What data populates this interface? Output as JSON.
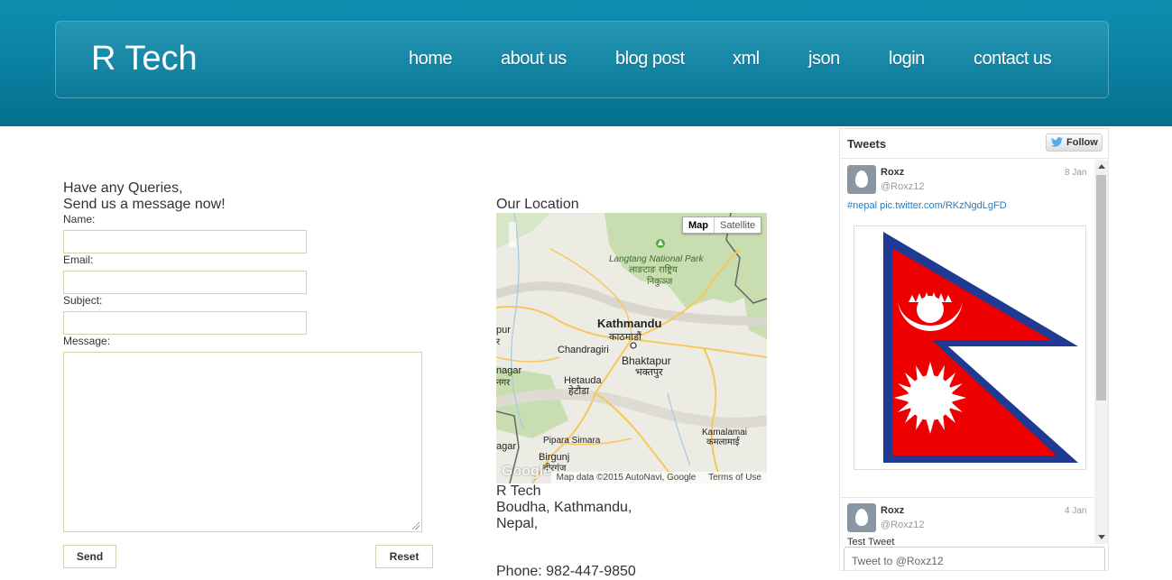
{
  "header": {
    "brand": "R Tech",
    "nav": [
      "home",
      "about us",
      "blog post",
      "xml",
      "json",
      "login",
      "contact us"
    ]
  },
  "contact": {
    "heading_line1": "Have any Queries,",
    "heading_line2": "Send us a message now!",
    "name_label": "Name:",
    "email_label": "Email:",
    "subject_label": "Subject:",
    "message_label": "Message:",
    "send_label": "Send",
    "reset_label": "Reset"
  },
  "location": {
    "heading": "Our Location",
    "map": {
      "map_button": "Map",
      "satellite_button": "Satellite",
      "attribution": "Map data ©2015 AutoNavi, Google",
      "terms": "Terms of Use",
      "google_logo": "Google",
      "places": [
        {
          "name": "Langtang National Park",
          "local": "लाङटाङ राष्ट्रिय निकुञ्ज"
        },
        {
          "name": "Kathmandu",
          "local": "काठमाडौं"
        },
        {
          "name": "Chandragiri",
          "local": ""
        },
        {
          "name": "Bhaktapur",
          "local": "भक्तपुर"
        },
        {
          "name": "Hetauda",
          "local": "हेटौडा"
        },
        {
          "name": "Pipara Simara",
          "local": ""
        },
        {
          "name": "Birgunj",
          "local": "बीरगंज"
        },
        {
          "name": "Kamalamai",
          "local": "कमलामाई"
        },
        {
          "name": "pur",
          "local": "र"
        },
        {
          "name": "nagar",
          "local": "नगर"
        },
        {
          "name": "agar",
          "local": ""
        }
      ]
    },
    "address_line1": "R Tech",
    "address_line2": "Boudha, Kathmandu,",
    "address_line3": "Nepal,",
    "phone": "Phone: 982-447-9850"
  },
  "twitter": {
    "title": "Tweets",
    "follow_label": "Follow",
    "tweets": [
      {
        "name": "Roxz",
        "handle": "@Roxz12",
        "date": "8 Jan",
        "text": "#nepal pic.twitter.com/RKzNgdLgFD"
      },
      {
        "name": "Roxz",
        "handle": "@Roxz12",
        "date": "4 Jan",
        "text": "Test Tweet"
      }
    ],
    "compose_placeholder": "Tweet to @Roxz12",
    "colors": {
      "flag_red": "#ee0000",
      "flag_blue": "#1f3a93",
      "link": "#2b7bb9"
    }
  }
}
